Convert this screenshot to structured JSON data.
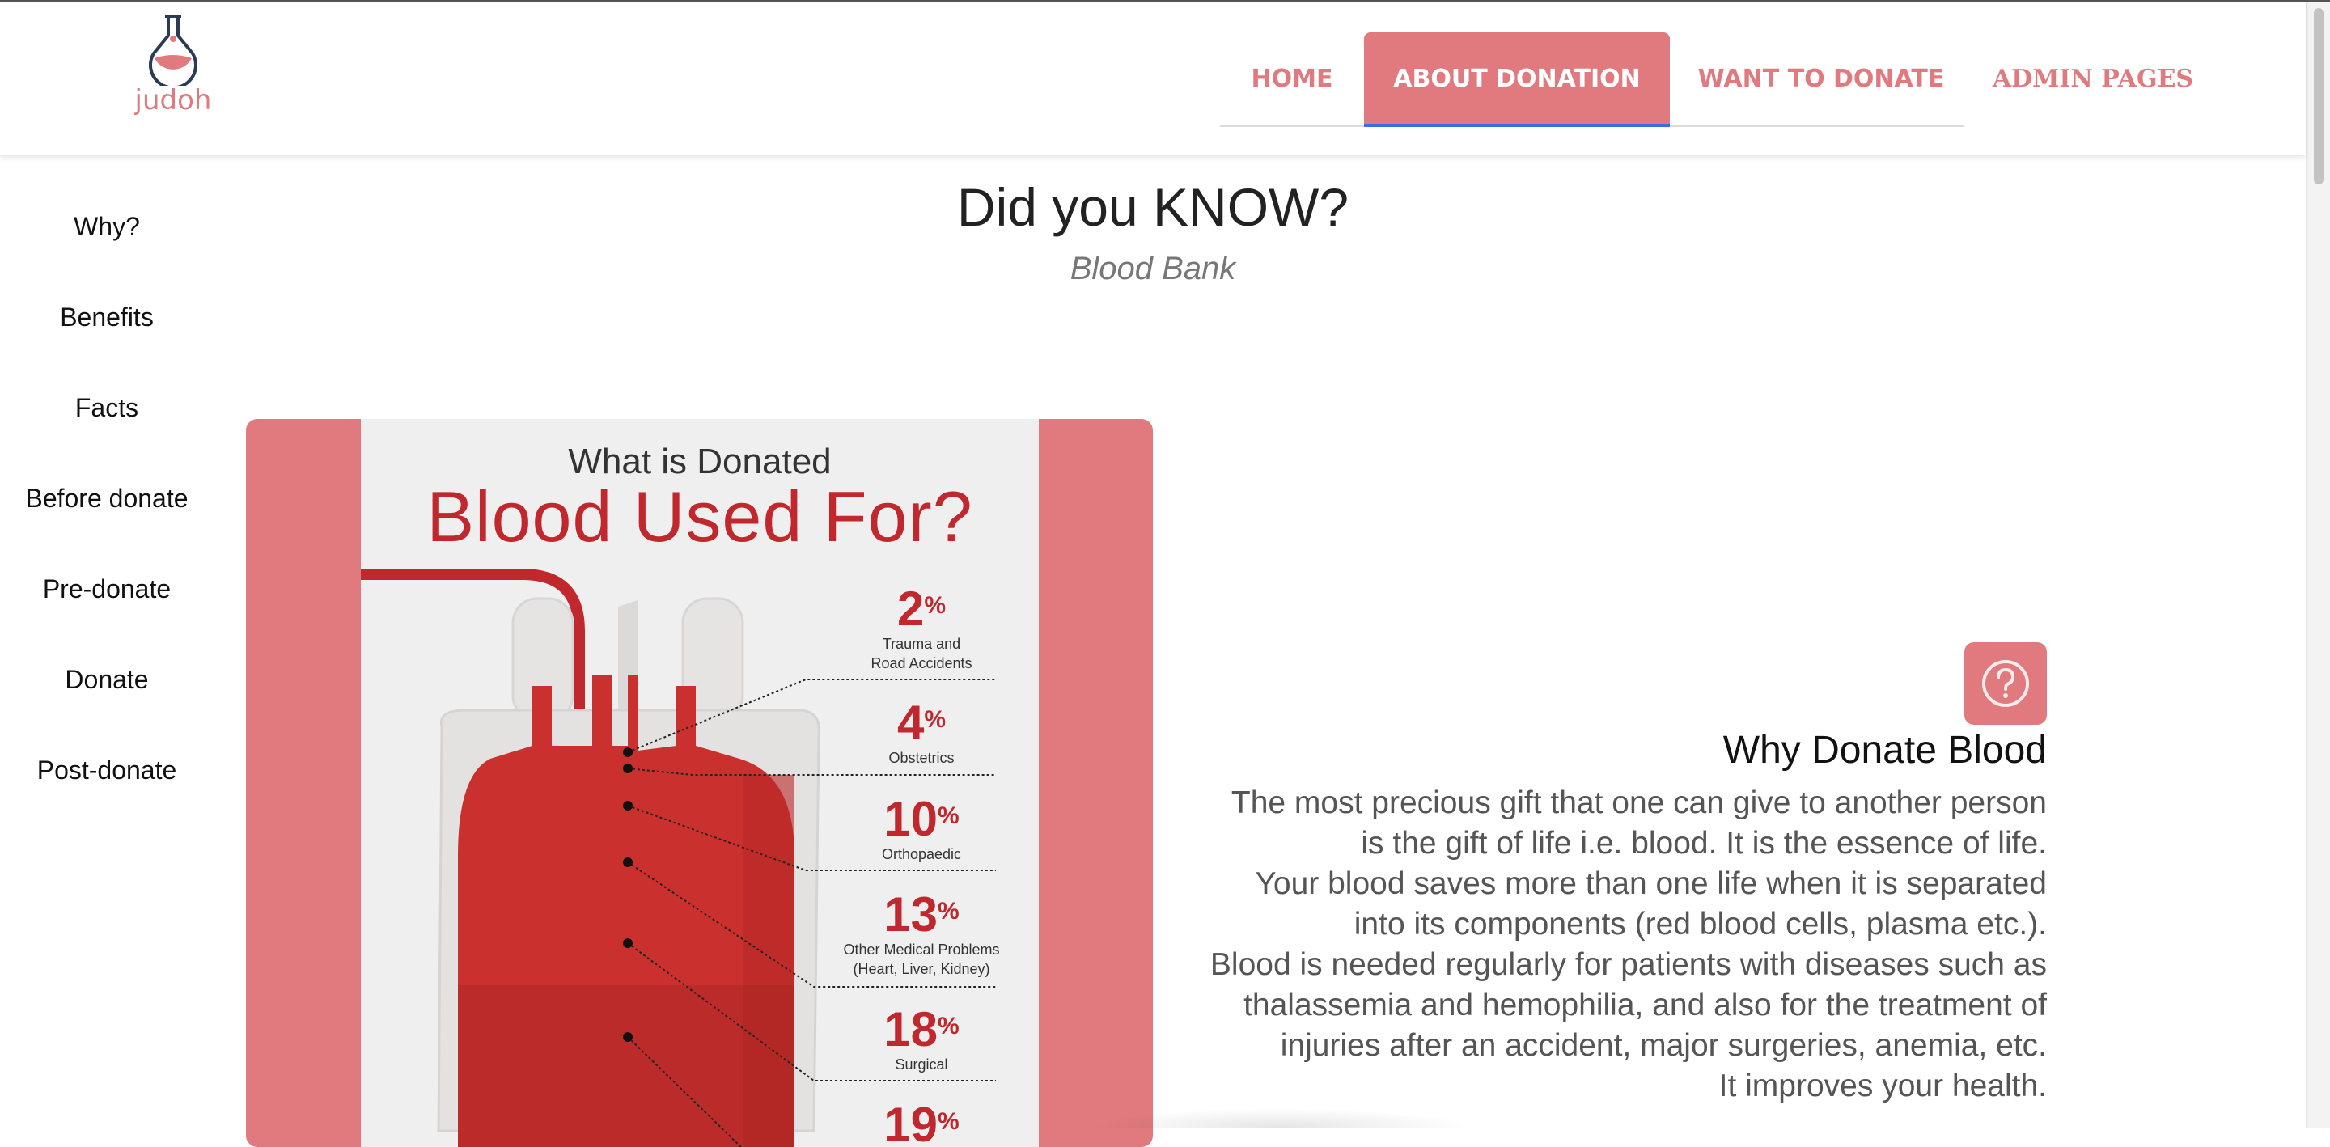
{
  "brand": {
    "name": "judoh",
    "accent": "#e07a7e",
    "active_underline": "#3b6cf0"
  },
  "nav": {
    "home": "HOME",
    "about": "ABOUT DONATION",
    "want": "WANT TO DONATE",
    "admin": "ADMIN PAGES"
  },
  "sidebar": {
    "items": [
      {
        "label": "Why?"
      },
      {
        "label": "Benefits"
      },
      {
        "label": "Facts"
      },
      {
        "label": "Before donate"
      },
      {
        "label": "Pre-donate"
      },
      {
        "label": "Donate"
      },
      {
        "label": "Post-donate"
      }
    ]
  },
  "main": {
    "title": "Did you KNOW?",
    "subtitle": "Blood Bank"
  },
  "infographic": {
    "line1": "What is Donated",
    "line2": "Blood Used For?",
    "stats": [
      {
        "value": "2",
        "unit": "%",
        "label1": "Trauma and",
        "label2": "Road Accidents"
      },
      {
        "value": "4",
        "unit": "%",
        "label1": "Obstetrics",
        "label2": ""
      },
      {
        "value": "10",
        "unit": "%",
        "label1": "Orthopaedic",
        "label2": ""
      },
      {
        "value": "13",
        "unit": "%",
        "label1": "Other Medical Problems",
        "label2": "(Heart, Liver, Kidney)"
      },
      {
        "value": "18",
        "unit": "%",
        "label1": "Surgical",
        "label2": ""
      },
      {
        "value": "19",
        "unit": "%",
        "label1": "",
        "label2": ""
      }
    ]
  },
  "why": {
    "icon": "question-circle-icon",
    "title": "Why Donate Blood",
    "lines": [
      "The most precious gift that one can give to another person",
      "is the gift of life i.e. blood. It is the essence of life.",
      "Your blood saves more than one life when it is separated",
      "into its components (red blood cells, plasma etc.).",
      "Blood is needed regularly for patients with diseases such as",
      "thalassemia and hemophilia, and also for the treatment of",
      "injuries after an accident, major surgeries, anemia, etc.",
      "It improves your health."
    ]
  }
}
